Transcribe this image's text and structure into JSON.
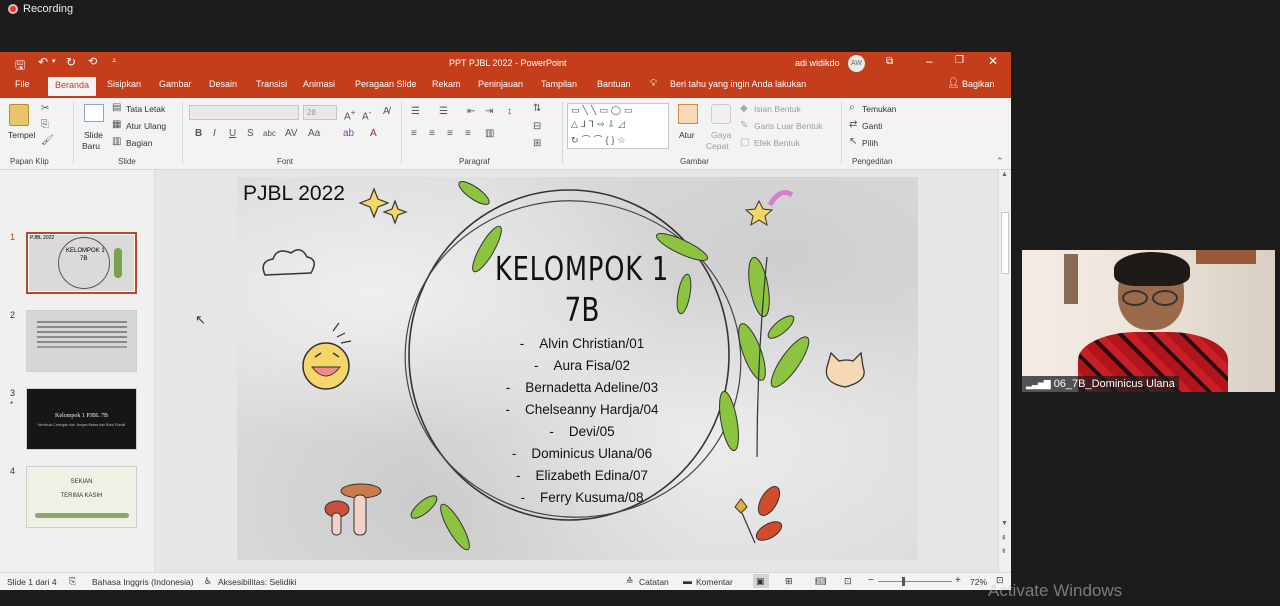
{
  "recording": {
    "label": "Recording"
  },
  "window": {
    "title": "PPT PJBL 2022  -  PowerPoint",
    "user_name": "adi widikdo",
    "user_initials": "AW",
    "accent": "#c43e1c"
  },
  "tabs": [
    "File",
    "Beranda",
    "Sisipkan",
    "Gambar",
    "Desain",
    "Transisi",
    "Animasi",
    "Peragaan Slide",
    "Rekam",
    "Peninjauan",
    "Tampilan",
    "Bantuan"
  ],
  "tell_me": "Beri tahu yang ingin Anda lakukan",
  "share": "Bagikan",
  "ribbon": {
    "clipboard": {
      "paste": "Tempel",
      "label": "Papan Klip"
    },
    "slides": {
      "new_slide_1": "Slide",
      "new_slide_2": "Baru",
      "layout": "Tata Letak",
      "reset": "Atur Ulang",
      "section": "Bagian",
      "label": "Slide"
    },
    "font": {
      "size": "28",
      "label": "Font"
    },
    "paragraph": {
      "label": "Paragraf"
    },
    "drawing": {
      "arrange": "Atur",
      "quick_styles_1": "Gaya",
      "quick_styles_2": "Cepat",
      "fill": "Isian Bentuk",
      "outline": "Garis Luar Bentuk",
      "effects": "Efek Bentuk",
      "label": "Gambar"
    },
    "editing": {
      "find": "Temukan",
      "replace": "Ganti",
      "select": "Pilih",
      "label": "Pengeditan"
    }
  },
  "thumbnails": [
    {
      "number": "1",
      "title": "KELOMPOK 1",
      "subtitle": "7B",
      "header": "PJBL 2022"
    },
    {
      "number": "2"
    },
    {
      "number": "3",
      "marker": "*",
      "title": "Kelompok 1 PJBL 7B",
      "subtitle": "Membuat Celengan dari Jangan Bekas dan Botol Plastik"
    },
    {
      "number": "4",
      "title": "SEKIAN",
      "subtitle": "TERIMA KASIH"
    }
  ],
  "slide": {
    "header": "PJBL 2022",
    "title_line1": "KELOMPOK 1",
    "title_line2": "7B",
    "members": [
      "Alvin Christian/01",
      "Aura Fisa/02",
      "Bernadetta Adeline/03",
      "Chelseanny Hardja/04",
      "Devi/05",
      "Dominicus Ulana/06",
      "Elizabeth Edina/07",
      "Ferry Kusuma/08"
    ]
  },
  "status_bar": {
    "slide_info": "Slide 1 dari 4",
    "language": "Bahasa Inggris (Indonesia)",
    "accessibility": "Aksesibilitas: Selidiki",
    "notes": "Catatan",
    "comments": "Komentar",
    "zoom": "72%"
  },
  "webcam": {
    "participant": "06_7B_Dominicus Ulana"
  },
  "watermark": "Activate Windows"
}
